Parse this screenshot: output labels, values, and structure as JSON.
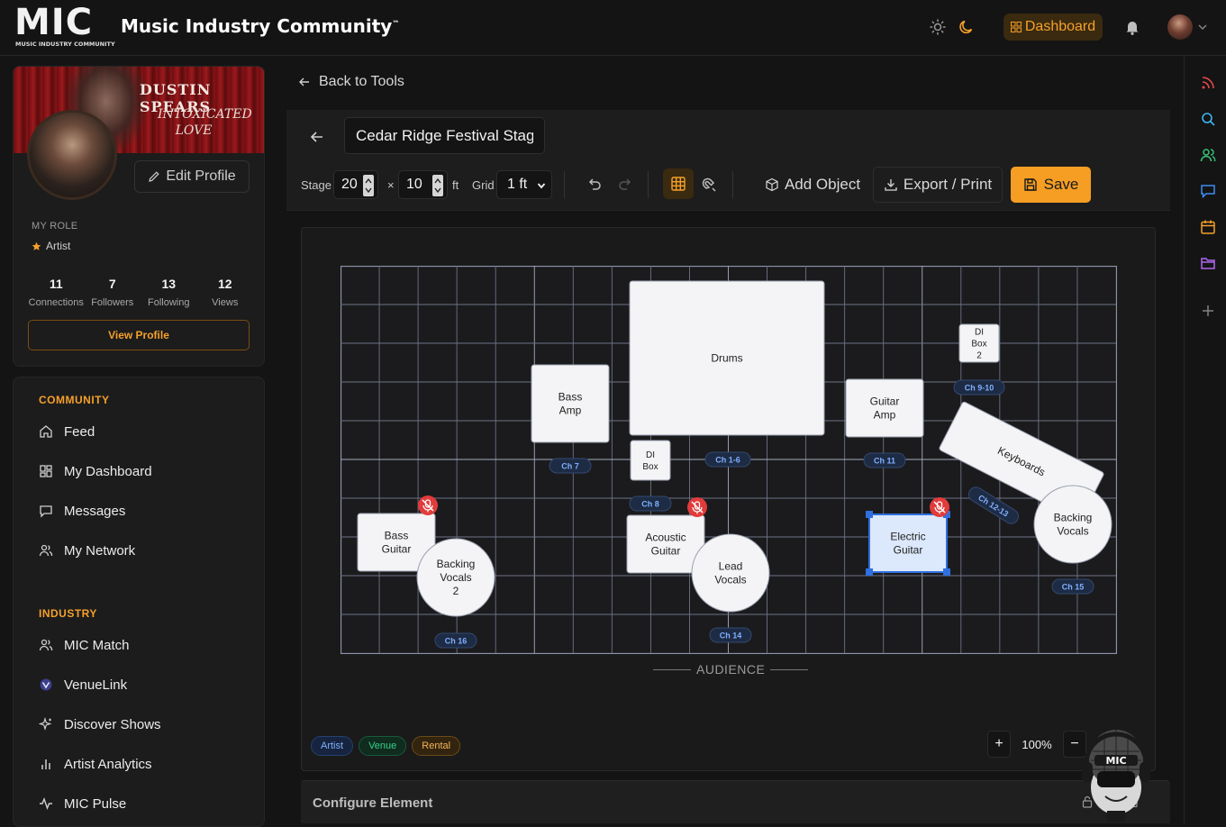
{
  "app": {
    "logo_text": "MIC",
    "logo_subtext": "MUSIC INDUSTRY COMMUNITY",
    "title": "Music Industry Community",
    "trademark": "™",
    "dashboard_label": "Dashboard"
  },
  "profile": {
    "banner_name": "DUSTIN SPEARS",
    "banner_subtitle": "INTOXICATED LOVE",
    "edit_label": "Edit Profile",
    "role_label": "MY ROLE",
    "role_value": "Artist",
    "stats": [
      {
        "value": "11",
        "label": "Connections"
      },
      {
        "value": "7",
        "label": "Followers"
      },
      {
        "value": "13",
        "label": "Following"
      },
      {
        "value": "12",
        "label": "Views"
      }
    ],
    "view_label": "View Profile"
  },
  "nav": {
    "community_heading": "COMMUNITY",
    "community_items": [
      {
        "label": "Feed",
        "icon": "home-icon"
      },
      {
        "label": "My Dashboard",
        "icon": "dashboard-icon"
      },
      {
        "label": "Messages",
        "icon": "message-icon"
      },
      {
        "label": "My Network",
        "icon": "network-icon"
      }
    ],
    "industry_heading": "INDUSTRY",
    "industry_items": [
      {
        "label": "MIC Match",
        "icon": "match-icon"
      },
      {
        "label": "VenueLink",
        "icon": "venuelink-icon"
      },
      {
        "label": "Discover Shows",
        "icon": "sparkle-icon"
      },
      {
        "label": "Artist Analytics",
        "icon": "bar-chart-icon"
      },
      {
        "label": "MIC Pulse",
        "icon": "pulse-icon"
      }
    ]
  },
  "main": {
    "back_label": "Back to Tools",
    "plot_name": "Cedar Ridge Festival Stage",
    "stage_label": "Stage",
    "stage_width": "20",
    "stage_x": "×",
    "stage_depth": "10",
    "unit": "ft",
    "grid_label": "Grid",
    "grid_value": "1 ft",
    "add_object_label": "Add Object",
    "export_label": "Export / Print",
    "save_label": "Save",
    "audience_label": "AUDIENCE",
    "zoom_in": "+",
    "zoom_value": "100%",
    "zoom_out": "−",
    "config_title": "Configure Element"
  },
  "legend": [
    {
      "label": "Artist",
      "color": "#7fb0ff"
    },
    {
      "label": "Venue",
      "color": "#37d08a"
    },
    {
      "label": "Rental",
      "color": "#f2b75a"
    }
  ],
  "stage_plot": {
    "objects": [
      {
        "type": "rect",
        "label": [
          "Drums"
        ],
        "selected": false
      },
      {
        "type": "rect",
        "label": [
          "Bass",
          "Amp"
        ],
        "selected": false
      },
      {
        "type": "rect",
        "label": [
          "DI",
          "Box"
        ],
        "selected": false
      },
      {
        "type": "rect",
        "label": [
          "Guitar",
          "Amp"
        ],
        "selected": false
      },
      {
        "type": "rect",
        "label": [
          "DI",
          "Box",
          "2"
        ],
        "selected": false
      },
      {
        "type": "rect",
        "label": [
          "Keyboards"
        ],
        "selected": false
      },
      {
        "type": "rect",
        "label": [
          "Bass",
          "Guitar"
        ],
        "selected": false,
        "muted": true
      },
      {
        "type": "rect",
        "label": [
          "Acoustic",
          "Guitar"
        ],
        "selected": false,
        "muted": true
      },
      {
        "type": "rect",
        "label": [
          "Electric",
          "Guitar"
        ],
        "selected": true,
        "muted": true
      },
      {
        "type": "circle",
        "label": [
          "Backing",
          "Vocals",
          "2"
        ]
      },
      {
        "type": "circle",
        "label": [
          "Lead",
          "Vocals"
        ]
      },
      {
        "type": "circle",
        "label": [
          "Backing",
          "Vocals"
        ]
      }
    ],
    "channels": [
      "Ch 7",
      "Ch 1-6",
      "Ch 8",
      "Ch 11",
      "Ch 9-10",
      "Ch 12-13",
      "Ch 15",
      "Ch 14",
      "Ch 16"
    ]
  }
}
